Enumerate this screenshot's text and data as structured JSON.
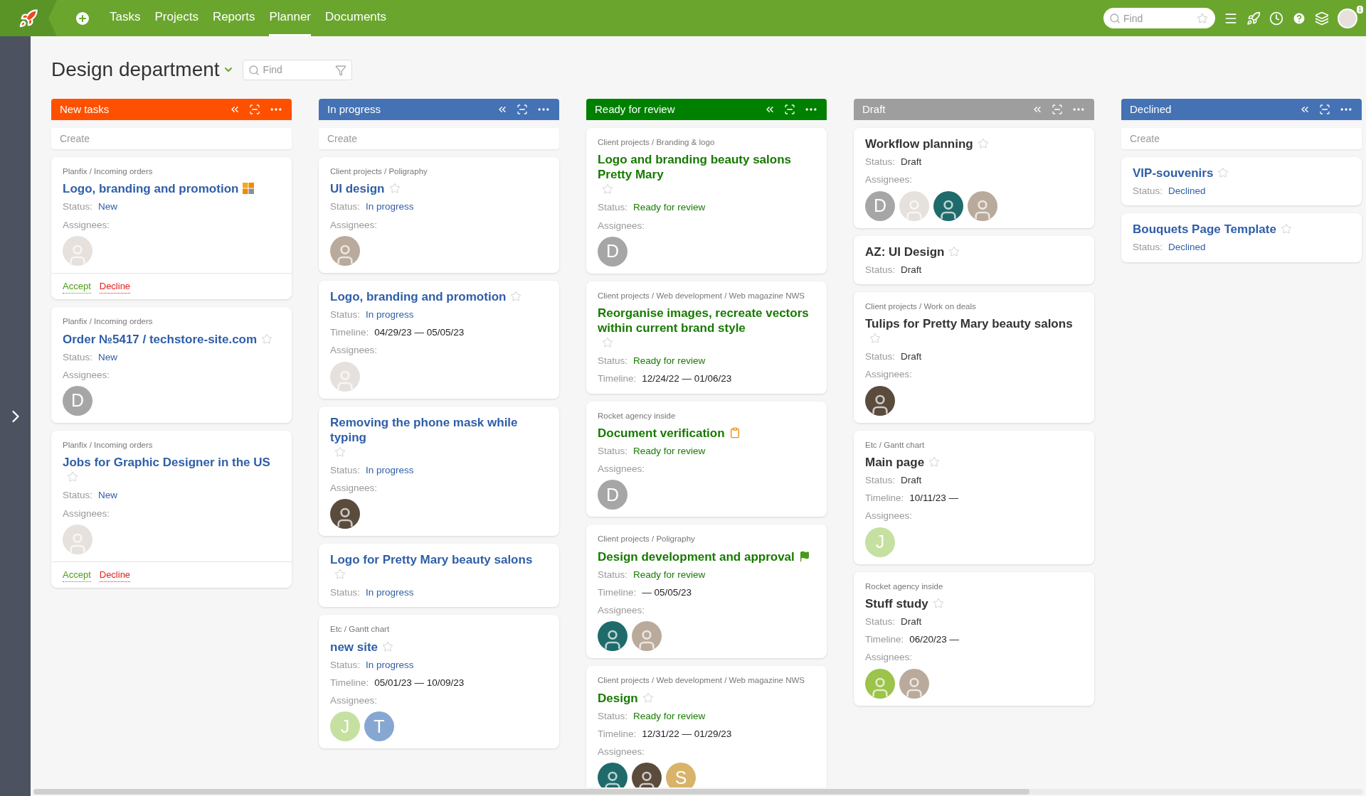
{
  "topbar": {
    "nav": [
      {
        "label": "Tasks",
        "selected": false
      },
      {
        "label": "Projects",
        "selected": false
      },
      {
        "label": "Reports",
        "selected": false
      },
      {
        "label": "Planner",
        "selected": true
      },
      {
        "label": "Documents",
        "selected": false
      }
    ],
    "search": {
      "placeholder": "Find"
    },
    "badge": "1"
  },
  "header": {
    "title": "Design department",
    "search": {
      "placeholder": "Find"
    }
  },
  "columns": [
    {
      "title": "New tasks",
      "kind": "new",
      "color": "#ff5000",
      "create": "Create",
      "cards": [
        {
          "path": "Planfix / Incoming orders",
          "title": "Logo, branding and promotion",
          "kind": "sticker",
          "status_label": "Status:",
          "status": "New",
          "assignees_label": "Assignees:",
          "assignees": [
            {
              "kind": "photo",
              "color": "#e6e1dc"
            }
          ],
          "actions": [
            "Accept",
            "Decline"
          ]
        },
        {
          "path": "Planfix / Incoming orders",
          "title": "Order №5417 / techstore-site.com",
          "kind": "star",
          "status_label": "Status:",
          "status": "New",
          "assignees_label": "Assignees:",
          "assignees": [
            {
              "kind": "letter",
              "letter": "D",
              "color": "#a6a6a6"
            }
          ]
        },
        {
          "path": "Planfix / Incoming orders",
          "title": "Jobs for Graphic Designer in the US",
          "kind": "star",
          "status_label": "Status:",
          "status": "New",
          "assignees_label": "Assignees:",
          "assignees": [
            {
              "kind": "photo",
              "color": "#e6e1dc"
            }
          ],
          "actions": [
            "Accept",
            "Decline"
          ]
        }
      ]
    },
    {
      "title": "In progress",
      "kind": "in_progress",
      "color": "#4472b4",
      "create": "Create",
      "cards": [
        {
          "path": "Client projects / Poligraphy",
          "title": "UI design",
          "kind": "star",
          "status_label": "Status:",
          "status": "In progress",
          "assignees_label": "Assignees:",
          "assignees": [
            {
              "kind": "photo",
              "color": "#b9aa9c"
            }
          ]
        },
        {
          "title": "Logo, branding and promotion",
          "kind": "star",
          "status_label": "Status:",
          "status": "In progress",
          "timeline_label": "Timeline:",
          "timeline": "04/29/23 — 05/05/23",
          "assignees_label": "Assignees:",
          "assignees": [
            {
              "kind": "photo",
              "color": "#e6e1dc"
            }
          ]
        },
        {
          "title": "Removing the phone mask while typing",
          "kind": "star",
          "status_label": "Status:",
          "status": "In progress",
          "assignees_label": "Assignees:",
          "assignees": [
            {
              "kind": "photo",
              "color": "#5a4b3c"
            }
          ]
        },
        {
          "title": "Logo for Pretty Mary beauty salons",
          "kind": "star",
          "status_label": "Status:",
          "status": "In progress"
        },
        {
          "path": "Etc / Gantt chart",
          "title": "new site",
          "kind": "star",
          "status_label": "Status:",
          "status": "In progress",
          "timeline_label": "Timeline:",
          "timeline": "05/01/23 — 10/09/23",
          "assignees_label": "Assignees:",
          "assignees": [
            {
              "kind": "letter",
              "letter": "J",
              "color": "#c5e0a0"
            },
            {
              "kind": "letter",
              "letter": "T",
              "color": "#87a7d3"
            }
          ]
        }
      ]
    },
    {
      "title": "Ready for review",
      "kind": "review",
      "color": "#008000",
      "cards": [
        {
          "path": "Client projects / Branding & logo",
          "title": "Logo and branding beauty salons Pretty Mary",
          "kind": "star",
          "status_label": "Status:",
          "status": "Ready for review",
          "assignees_label": "Assignees:",
          "assignees": [
            {
              "kind": "letter",
              "letter": "D",
              "color": "#a6a6a6"
            }
          ]
        },
        {
          "path": "Client projects / Web development / Web magazine NWS",
          "title": "Reorganise images, recreate vectors within current brand style",
          "kind": "star",
          "status_label": "Status:",
          "status": "Ready for review",
          "timeline_label": "Timeline:",
          "timeline": "12/24/22 — 01/06/23"
        },
        {
          "path": "Rocket agency inside",
          "title": "Document verification",
          "kind": "clipboard",
          "status_label": "Status:",
          "status": "Ready for review",
          "assignees_label": "Assignees:",
          "assignees": [
            {
              "kind": "letter",
              "letter": "D",
              "color": "#a6a6a6"
            }
          ]
        },
        {
          "path": "Client projects / Poligraphy",
          "title": "Design development and approval",
          "kind": "flag",
          "status_label": "Status:",
          "status": "Ready for review",
          "timeline_label": "Timeline:",
          "timeline": "— 05/05/23",
          "assignees_label": "Assignees:",
          "assignees": [
            {
              "kind": "photo",
              "color": "#1f6b6b"
            },
            {
              "kind": "photo",
              "color": "#b9aa9c"
            }
          ]
        },
        {
          "path": "Client projects / Web development / Web magazine NWS",
          "title": "Design",
          "kind": "star",
          "status_label": "Status:",
          "status": "Ready for review",
          "timeline_label": "Timeline:",
          "timeline": "12/31/22 — 01/29/23",
          "assignees_label": "Assignees:",
          "assignees": [
            {
              "kind": "photo",
              "color": "#1f6b6b"
            },
            {
              "kind": "photo",
              "color": "#5a4b3c"
            },
            {
              "kind": "letter",
              "letter": "S",
              "color": "#d8b36a"
            }
          ]
        }
      ]
    },
    {
      "title": "Draft",
      "kind": "draft",
      "color": "#9e9e9e",
      "cards": [
        {
          "title": "Workflow planning",
          "kind": "star",
          "status_label": "Status:",
          "status": "Draft",
          "assignees_label": "Assignees:",
          "assignees": [
            {
              "kind": "letter",
              "letter": "D",
              "color": "#a6a6a6"
            },
            {
              "kind": "photo",
              "color": "#e6e1dc"
            },
            {
              "kind": "photo",
              "color": "#1f6b6b"
            },
            {
              "kind": "photo",
              "color": "#b9aa9c"
            }
          ]
        },
        {
          "title": "AZ: UI Design",
          "kind": "star",
          "status_label": "Status:",
          "status": "Draft"
        },
        {
          "path": "Client projects / Work on deals",
          "title": "Tulips for Pretty Mary beauty salons",
          "kind": "star",
          "status_label": "Status:",
          "status": "Draft",
          "assignees_label": "Assignees:",
          "assignees": [
            {
              "kind": "photo",
              "color": "#5a4b3c"
            }
          ]
        },
        {
          "path": "Etc / Gantt chart",
          "title": "Main page",
          "kind": "star",
          "status_label": "Status:",
          "status": "Draft",
          "timeline_label": "Timeline:",
          "timeline": "10/11/23 —",
          "assignees_label": "Assignees:",
          "assignees": [
            {
              "kind": "letter",
              "letter": "J",
              "color": "#c5e0a0"
            }
          ]
        },
        {
          "path": "Rocket agency inside",
          "title": "Stuff study",
          "kind": "star",
          "status_label": "Status:",
          "status": "Draft",
          "timeline_label": "Timeline:",
          "timeline": "06/20/23 —",
          "assignees_label": "Assignees:",
          "assignees": [
            {
              "kind": "photo",
              "color": "#9cc34a"
            },
            {
              "kind": "photo",
              "color": "#b9aa9c"
            }
          ]
        }
      ]
    },
    {
      "title": "Declined",
      "kind": "declined",
      "color": "#4472b4",
      "create": "Create",
      "cards": [
        {
          "title": "VIP-souvenirs",
          "kind": "star",
          "status_label": "Status:",
          "status": "Declined"
        },
        {
          "title": "Bouquets Page Template",
          "kind": "star",
          "status_label": "Status:",
          "status": "Declined"
        }
      ]
    }
  ]
}
